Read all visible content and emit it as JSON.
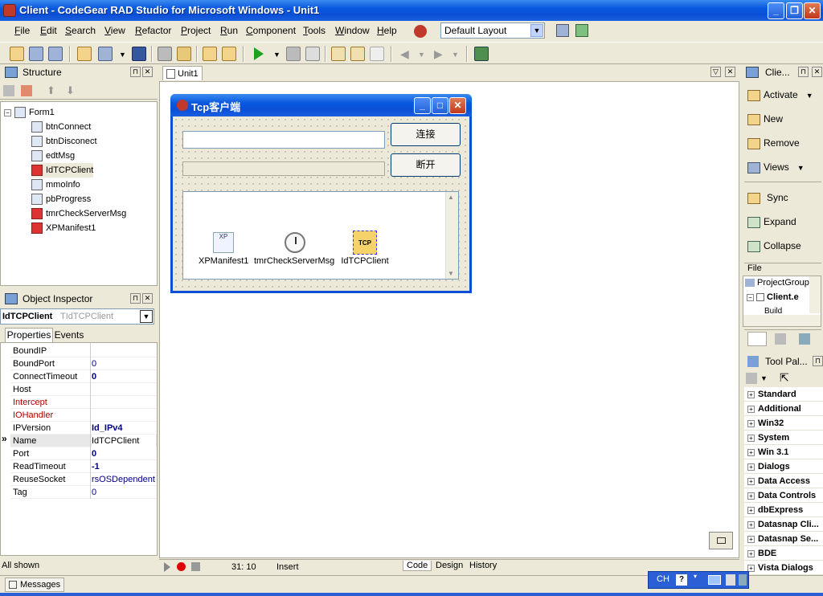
{
  "window": {
    "title": "Client - CodeGear RAD Studio for Microsoft Windows - Unit1"
  },
  "menu": [
    {
      "label": "File",
      "key": "F",
      "rest": "ile"
    },
    {
      "label": "Edit",
      "key": "E",
      "rest": "dit"
    },
    {
      "label": "Search",
      "key": "S",
      "rest": "earch"
    },
    {
      "label": "View",
      "key": "V",
      "rest": "iew"
    },
    {
      "label": "Refactor",
      "key": "R",
      "rest": "efactor"
    },
    {
      "label": "Project",
      "key": "P",
      "rest": "roject"
    },
    {
      "label": "Run",
      "key": "R",
      "rest": "un"
    },
    {
      "label": "Component",
      "key": "C",
      "rest": "omponent"
    },
    {
      "label": "Tools",
      "key": "T",
      "rest": "ools"
    },
    {
      "label": "Window",
      "key": "W",
      "rest": "indow"
    },
    {
      "label": "Help",
      "key": "H",
      "rest": "elp"
    }
  ],
  "layout_select": {
    "value": "Default Layout"
  },
  "structure": {
    "title": "Structure",
    "root": "Form1",
    "items": [
      {
        "name": "btnConnect",
        "icon": "edit-comp-icon"
      },
      {
        "name": "btnDisconect",
        "icon": "edit-comp-icon"
      },
      {
        "name": "edtMsg",
        "icon": "edit-comp-icon"
      },
      {
        "name": "IdTCPClient",
        "icon": "tcp-comp-icon"
      },
      {
        "name": "mmoInfo",
        "icon": "edit-comp-icon"
      },
      {
        "name": "pbProgress",
        "icon": "edit-comp-icon"
      },
      {
        "name": "tmrCheckServerMsg",
        "icon": "tcp-comp-icon"
      },
      {
        "name": "XPManifest1",
        "icon": "tcp-comp-icon"
      }
    ]
  },
  "object_inspector": {
    "title": "Object Inspector",
    "selected_name": "IdTCPClient",
    "selected_type": "TIdTCPClient",
    "tabs": [
      "Properties",
      "Events"
    ],
    "rows": [
      {
        "key": "BoundIP",
        "value": "",
        "red": false,
        "bold": false
      },
      {
        "key": "BoundPort",
        "value": "0",
        "red": false,
        "bold": false
      },
      {
        "key": "ConnectTimeout",
        "value": "0",
        "red": false,
        "bold": true
      },
      {
        "key": "Host",
        "value": "",
        "red": false,
        "bold": false
      },
      {
        "key": "Intercept",
        "value": "",
        "red": true,
        "bold": false
      },
      {
        "key": "IOHandler",
        "value": "",
        "red": true,
        "bold": false
      },
      {
        "key": "IPVersion",
        "value": "Id_IPv4",
        "red": false,
        "bold": true
      },
      {
        "key": "Name",
        "value": "IdTCPClient",
        "red": false,
        "bold": false
      },
      {
        "key": "Port",
        "value": "0",
        "red": false,
        "bold": true
      },
      {
        "key": "ReadTimeout",
        "value": "-1",
        "red": false,
        "bold": true
      },
      {
        "key": "ReuseSocket",
        "value": "rsOSDependent",
        "red": false,
        "bold": false
      },
      {
        "key": "Tag",
        "value": "0",
        "red": false,
        "bold": false
      }
    ],
    "selected_row_marker": "»",
    "footer": "All shown"
  },
  "editor": {
    "tab": "Unit1",
    "status_pos": "31: 10",
    "status_mode": "Insert",
    "bottom_tabs": [
      "Code",
      "Design",
      "History"
    ]
  },
  "form": {
    "title": "Tcp客户端",
    "btn_connect": "连接",
    "btn_disconnect": "断开",
    "components": [
      {
        "name": "XPManifest1",
        "badge": "XP"
      },
      {
        "name": "tmrCheckServerMsg",
        "badge": ""
      },
      {
        "name": "IdTCPClient",
        "badge": "TCP"
      }
    ]
  },
  "project_manager": {
    "title": "Clie...",
    "buttons": [
      "Activate",
      "New",
      "Remove",
      "Views",
      "Sync",
      "Expand",
      "Collapse"
    ],
    "file_label": "File",
    "tree": [
      "ProjectGroup",
      "Client.e",
      "Build"
    ]
  },
  "tool_palette": {
    "title": "Tool Pal...",
    "categories": [
      "Standard",
      "Additional",
      "Win32",
      "System",
      "Win 3.1",
      "Dialogs",
      "Data Access",
      "Data Controls",
      "dbExpress",
      "Datasnap Cli...",
      "Datasnap Se...",
      "BDE",
      "Vista Dialogs"
    ]
  },
  "messages": {
    "label": "Messages"
  },
  "ime": {
    "label": "CH"
  }
}
